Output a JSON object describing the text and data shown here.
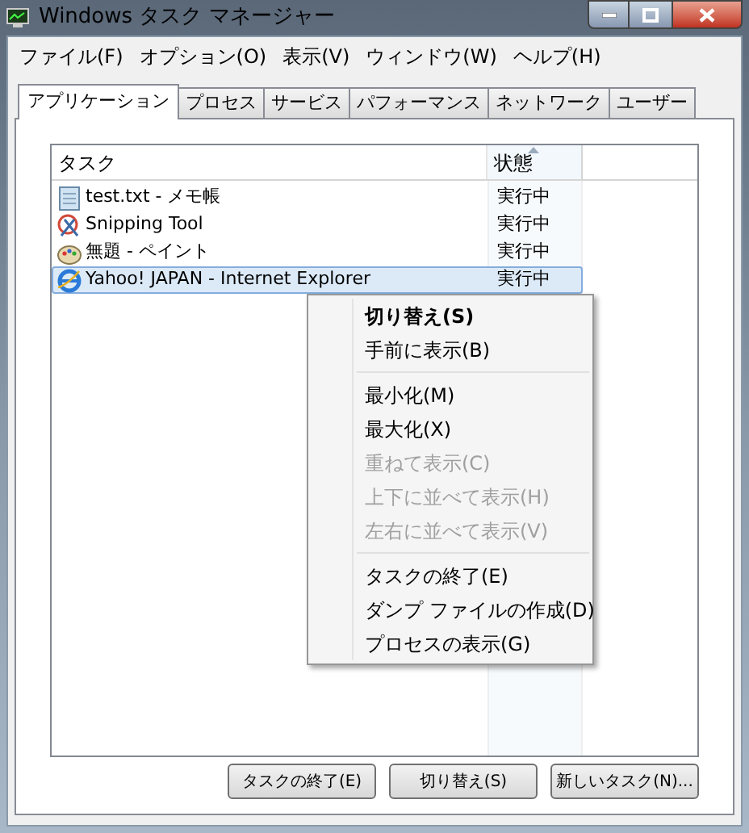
{
  "window": {
    "title": "Windows タスク マネージャー"
  },
  "menu_bar": [
    "ファイル(F)",
    "オプション(O)",
    "表示(V)",
    "ウィンドウ(W)",
    "ヘルプ(H)"
  ],
  "tabs": [
    {
      "label": "アプリケーション",
      "selected": true
    },
    {
      "label": "プロセス",
      "selected": false
    },
    {
      "label": "サービス",
      "selected": false
    },
    {
      "label": "パフォーマンス",
      "selected": false
    },
    {
      "label": "ネットワーク",
      "selected": false
    },
    {
      "label": "ユーザー",
      "selected": false
    }
  ],
  "task_list": {
    "columns": [
      {
        "label": "タスク",
        "sorted": false
      },
      {
        "label": "状態",
        "sorted": true
      }
    ],
    "rows": [
      {
        "task": "test.txt - メモ帳",
        "status": "実行中",
        "selected": false
      },
      {
        "task": "Snipping Tool",
        "status": "実行中",
        "selected": false
      },
      {
        "task": "無題 - ペイント",
        "status": "実行中",
        "selected": false
      },
      {
        "task": "Yahoo! JAPAN - Internet Explorer",
        "status": "実行中",
        "selected": true
      }
    ]
  },
  "context_menu": [
    {
      "kind": "item",
      "label": "切り替え(S)",
      "default": true,
      "disabled": false
    },
    {
      "kind": "item",
      "label": "手前に表示(B)",
      "default": false,
      "disabled": false
    },
    {
      "kind": "separator"
    },
    {
      "kind": "item",
      "label": "最小化(M)",
      "default": false,
      "disabled": false
    },
    {
      "kind": "item",
      "label": "最大化(X)",
      "default": false,
      "disabled": false
    },
    {
      "kind": "item",
      "label": "重ねて表示(C)",
      "default": false,
      "disabled": true
    },
    {
      "kind": "item",
      "label": "上下に並べて表示(H)",
      "default": false,
      "disabled": true
    },
    {
      "kind": "item",
      "label": "左右に並べて表示(V)",
      "default": false,
      "disabled": true
    },
    {
      "kind": "separator"
    },
    {
      "kind": "item",
      "label": "タスクの終了(E)",
      "default": false,
      "disabled": false
    },
    {
      "kind": "item",
      "label": "ダンプ ファイルの作成(D)",
      "default": false,
      "disabled": false
    },
    {
      "kind": "item",
      "label": "プロセスの表示(G)",
      "default": false,
      "disabled": false
    }
  ],
  "buttons": [
    "タスクの終了(E)",
    "切り替え(S)",
    "新しいタスク(N)..."
  ]
}
